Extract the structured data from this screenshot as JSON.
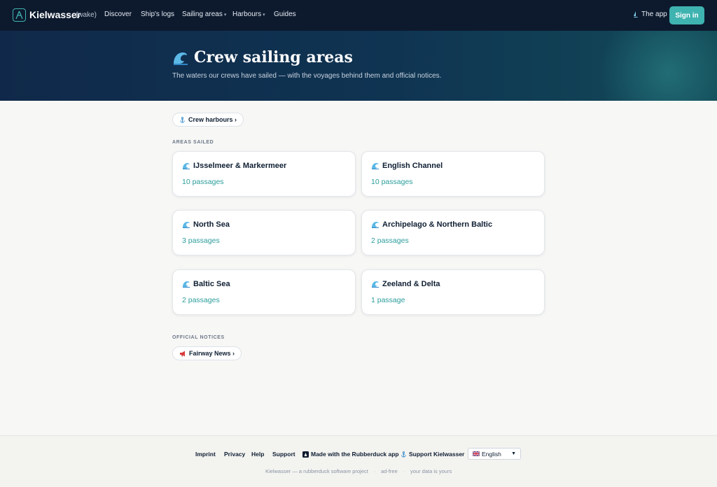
{
  "nav": {
    "brand": "Kielwasser",
    "brand_tag": "(wake)",
    "links": [
      {
        "label": "Discover",
        "caret": ""
      },
      {
        "label": "Ship's logs",
        "caret": ""
      },
      {
        "label": "Sailing areas",
        "caret": "▾"
      },
      {
        "label": "Harbours",
        "caret": "▾"
      },
      {
        "label": "Guides",
        "caret": ""
      }
    ],
    "app_icon": "sailboat-icon",
    "app_label": "The app",
    "signin_label": "Sign in"
  },
  "hero": {
    "icon": "wave-icon",
    "title": "Crew sailing areas",
    "subtitle": "The waters our crews have sailed — with the voyages behind them and official notices."
  },
  "harbours_pill": {
    "icon": "anchor-icon",
    "label": "Crew harbours ›"
  },
  "areas_section": {
    "label": "AREAS SAILED",
    "cards": [
      {
        "name": "IJsselmeer & Markermeer",
        "passages": "10 passages"
      },
      {
        "name": "English Channel",
        "passages": "10 passages"
      },
      {
        "name": "North Sea",
        "passages": "3 passages"
      },
      {
        "name": "Archipelago & Northern Baltic",
        "passages": "2 passages"
      },
      {
        "name": "Baltic Sea",
        "passages": "2 passages"
      },
      {
        "name": "Zeeland & Delta",
        "passages": "1 passage"
      }
    ]
  },
  "notices_section": {
    "label": "OFFICIAL NOTICES",
    "pill": {
      "icon": "megaphone-icon",
      "label": "Fairway News ›"
    }
  },
  "footer": {
    "links": [
      "Imprint",
      "Privacy",
      "Help",
      "Support"
    ],
    "made_with": "Made with the Rubberduck app",
    "support_kielwasser": "Support Kielwasser",
    "language": "English",
    "bottom": [
      "Kielwasser — a rubberduck software project",
      "ad-free",
      "your data is yours"
    ]
  },
  "colors": {
    "accent": "#3fb3b0",
    "nav_bg": "#0d1a2e",
    "hero_bg": "#10294a",
    "passage_text": "#2a9d9a"
  }
}
